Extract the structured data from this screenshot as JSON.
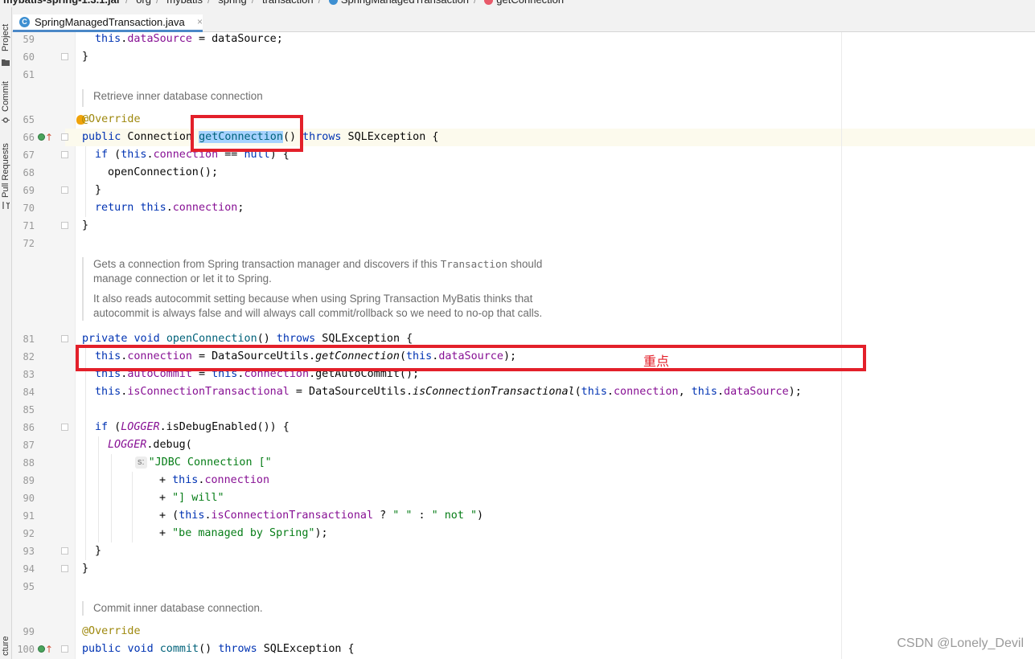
{
  "breadcrumb": {
    "items": [
      "mybatis-spring-1.3.1.jar",
      "org",
      "mybatis",
      "spring",
      "transaction",
      "SpringManagedTransaction",
      "getConnection"
    ]
  },
  "side_tabs": {
    "project": "Project",
    "commit": "Commit",
    "pull_requests": "Pull Requests",
    "structure": "cture"
  },
  "editor_tab": {
    "filename": "SpringManagedTransaction.java",
    "class_icon_letter": "C",
    "close": "×"
  },
  "line_numbers": [
    "59",
    "60",
    "61",
    "65",
    "66",
    "67",
    "68",
    "69",
    "70",
    "71",
    "72",
    "81",
    "82",
    "83",
    "84",
    "85",
    "86",
    "87",
    "88",
    "89",
    "90",
    "91",
    "92",
    "93",
    "94",
    "95",
    "99",
    "100"
  ],
  "docs": {
    "retrieve": "Retrieve inner database connection",
    "gets_1a": "Gets a connection from Spring transaction manager and discovers if this ",
    "gets_1b": "Transaction",
    "gets_1c": " should",
    "gets_2": "manage connection or let it to Spring.",
    "also_1": "It also reads autocommit setting because when using Spring Transaction MyBatis thinks that",
    "also_2": "autocommit is always false and will always call commit/rollback so we need to no-op that calls.",
    "commit": "Commit inner database connection."
  },
  "code": {
    "l59_a": "this",
    "l59_b": ".",
    "l59_c": "dataSource",
    "l59_d": " = dataSource;",
    "l60": "}",
    "l65": "@Override",
    "l66_kw": "public",
    "l66_a": " Connection ",
    "l66_m": "getConnection",
    "l66_b": "() ",
    "l66_kw2": "throws",
    "l66_c": " SQLException {",
    "l67_kw": "if",
    "l67_a": " (",
    "l67_kw2": "this",
    "l67_b": ".",
    "l67_f": "connection",
    "l67_c": " == ",
    "l67_kw3": "null",
    "l67_d": ") {",
    "l68": "openConnection();",
    "l69": "}",
    "l70_kw": "return",
    "l70_a": " ",
    "l70_kw2": "this",
    "l70_b": ".",
    "l70_f": "connection",
    "l70_c": ";",
    "l71": "}",
    "l81_kw": "private",
    "l81_a": " ",
    "l81_kw2": "void",
    "l81_b": " ",
    "l81_m": "openConnection",
    "l81_c": "() ",
    "l81_kw3": "throws",
    "l81_d": " SQLException {",
    "l82_kw": "this",
    "l82_a": ".",
    "l82_f": "connection",
    "l82_b": " = DataSourceUtils.",
    "l82_m": "getConnection",
    "l82_c": "(",
    "l82_kw2": "this",
    "l82_d": ".",
    "l82_f2": "dataSource",
    "l82_e": ");",
    "l83_kw": "this",
    "l83_a": ".",
    "l83_f": "autoCommit",
    "l83_b": " = ",
    "l83_kw2": "this",
    "l83_c": ".",
    "l83_f2": "connection",
    "l83_d": ".getAutoCommit();",
    "l84_kw": "this",
    "l84_a": ".",
    "l84_f": "isConnectionTransactional",
    "l84_b": " = DataSourceUtils.",
    "l84_m": "isConnectionTransactional",
    "l84_c": "(",
    "l84_kw2": "this",
    "l84_d": ".",
    "l84_f2": "connection",
    "l84_e": ", ",
    "l84_kw3": "this",
    "l84_g": ".",
    "l84_f3": "dataSource",
    "l84_h": ");",
    "l86_kw": "if",
    "l86_a": " (",
    "l86_lg": "LOGGER",
    "l86_b": ".isDebugEnabled()) {",
    "l87_lg": "LOGGER",
    "l87_a": ".debug(",
    "l88_hint": "s:",
    "l88_s": "\"JDBC Connection [\"",
    "l89_a": "+ ",
    "l89_kw": "this",
    "l89_b": ".",
    "l89_f": "connection",
    "l90_a": "+ ",
    "l90_s": "\"] will\"",
    "l91_a": "+ (",
    "l91_kw": "this",
    "l91_b": ".",
    "l91_f": "isConnectionTransactional",
    "l91_c": " ? ",
    "l91_s1": "\" \"",
    "l91_d": " : ",
    "l91_s2": "\" not \"",
    "l91_e": ")",
    "l92_a": "+ ",
    "l92_s": "\"be managed by Spring\"",
    "l92_b": ");",
    "l93": "}",
    "l94": "}",
    "l99": "@Override",
    "l100_kw": "public",
    "l100_a": " ",
    "l100_kw2": "void",
    "l100_b": " ",
    "l100_m": "commit",
    "l100_c": "() ",
    "l100_kw3": "throws",
    "l100_d": " SQLException {"
  },
  "annotation_label": "重点",
  "watermark": "CSDN @Lonely_Devil",
  "colors": {
    "keyword": "#0033b3",
    "field": "#871094",
    "method": "#00627a",
    "string": "#067d17",
    "annotation": "#9e880d",
    "highlight_box": "#e3202a"
  }
}
